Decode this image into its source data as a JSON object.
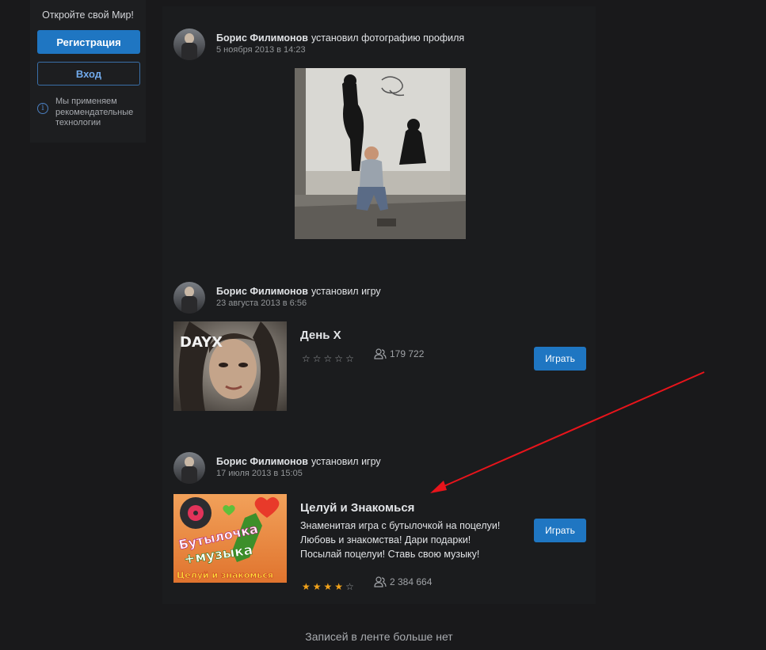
{
  "sidebar": {
    "title": "Откройте свой Мир!",
    "register_label": "Регистрация",
    "login_label": "Вход",
    "info_icon": "i",
    "info_text": "Мы применяем рекомендательные технологии"
  },
  "posts": [
    {
      "author": "Борис Филимонов",
      "action": "установил фотографию профиля",
      "date": "5 ноября 2013 в 14:23"
    },
    {
      "author": "Борис Филимонов",
      "action": "установил игру",
      "date": "23 августа 2013 в 6:56",
      "game": {
        "title": "День X",
        "thumb_text": "DAYX",
        "rating": 0,
        "players": "179 722",
        "play_label": "Играть"
      }
    },
    {
      "author": "Борис Филимонов",
      "action": "установил игру",
      "date": "17 июля 2013 в 15:05",
      "game": {
        "title": "Целуй и Знакомься",
        "thumb_line1": "Бутылочка",
        "thumb_line2": "+музыка",
        "thumb_line3": "Целуй и знакомься",
        "description": [
          "Знаменитая игра с бутылочкой на поцелуи!",
          "Любовь и знакомства! Дари подарки!",
          "Посылай поцелуи! Ставь свою музыку!"
        ],
        "rating": 4,
        "players": "2 384 664",
        "play_label": "Играть"
      }
    }
  ],
  "feed_end": "Записей в ленте больше нет",
  "colors": {
    "background": "#19191b",
    "accent": "#1f76c2",
    "star": "#f3a31a",
    "arrow": "#e8141b"
  },
  "icons": [
    "info-icon",
    "star-icon",
    "users-icon",
    "arrow-annotation"
  ]
}
